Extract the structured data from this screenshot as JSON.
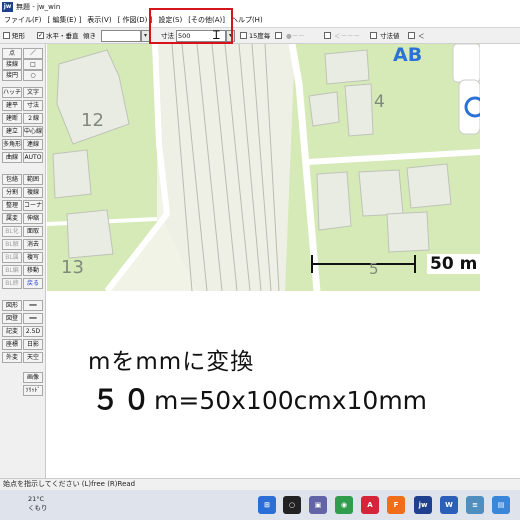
{
  "window": {
    "title": "無題 - jw_win",
    "app_icon_text": "jw"
  },
  "menu": [
    "ファイル(F)",
    "[ 編集(E) ]",
    "表示(V)",
    "[ 作図(D) ]",
    "設定(S)",
    "[その他(A)]",
    "ヘルプ(H)"
  ],
  "toolbar": {
    "rect_label": "矩形",
    "hv_label": "水平・垂直",
    "slope_label": "傾き",
    "dim_label": "寸法",
    "dim_value": "500",
    "step15_label": "15度毎",
    "dim_value_label": "寸法値",
    "disabled_a": "●－－",
    "disabled_b": "＜－－－",
    "lt_label": "＜"
  },
  "left_tools": [
    [
      "点",
      "／"
    ],
    [
      "接線",
      "□"
    ],
    [
      "接円",
      "○"
    ],
    [
      "ハッチ",
      "文字"
    ],
    [
      "建平",
      "寸法"
    ],
    [
      "建断",
      "２線"
    ],
    [
      "建立",
      "中心線"
    ],
    [
      "多角形",
      "連線"
    ],
    [
      "曲線",
      "AUTO"
    ],
    [
      "包絡",
      "範囲"
    ],
    [
      "分割",
      "複線"
    ],
    [
      "整理",
      "コーナー"
    ],
    [
      "属変",
      "伸縮"
    ],
    [
      "BL化",
      "面取"
    ],
    [
      "BL解",
      "消去"
    ],
    [
      "BL属",
      "複写"
    ],
    [
      "BL編",
      "移動"
    ],
    [
      "BL終",
      "戻る"
    ],
    [
      "図形",
      "━━"
    ],
    [
      "図登",
      "━━"
    ],
    [
      "記変",
      "2.5D"
    ],
    [
      "座標",
      "日影"
    ],
    [
      "外変",
      "天空"
    ],
    [
      "",
      "画像"
    ],
    [
      "",
      "ｿﾘｯﾄﾞ"
    ]
  ],
  "map": {
    "labels": {
      "block4": "4",
      "block12": "12",
      "block13": "13",
      "block5": "5",
      "ab": "AB"
    },
    "scale_label": "50 m"
  },
  "caption": {
    "line1": "mをmmに変換",
    "line2_big": "５０",
    "line2_rest": "m=50x100cmx10mm"
  },
  "status": {
    "text": "始点を指示してください (L)free (R)Read"
  },
  "taskbar": {
    "weather_temp": "21°C",
    "weather_cond": "くもり",
    "icons": [
      {
        "name": "windows-start-icon",
        "glyph": "⊞",
        "color": "#2b6fd6"
      },
      {
        "name": "search-icon",
        "glyph": "○",
        "color": "#222222"
      },
      {
        "name": "teams-icon",
        "glyph": "▣",
        "color": "#6264a7"
      },
      {
        "name": "chrome-icon",
        "glyph": "◉",
        "color": "#2f9d4c"
      },
      {
        "name": "acrobat-icon",
        "glyph": "A",
        "color": "#d6243a"
      },
      {
        "name": "f-app-icon",
        "glyph": "F",
        "color": "#f06d1a"
      },
      {
        "name": "jwwin-icon",
        "glyph": "jw",
        "color": "#1f3f8f"
      },
      {
        "name": "word-icon",
        "glyph": "W",
        "color": "#2b5fb8"
      },
      {
        "name": "notepad-icon",
        "glyph": "≡",
        "color": "#4f8fc0"
      },
      {
        "name": "photos-icon",
        "glyph": "▤",
        "color": "#3a86d8"
      }
    ]
  },
  "colors": {
    "highlight": "#d6131b",
    "map_green": "#d5eab6",
    "map_building": "#e9ece2",
    "scale_bar": "#111111"
  }
}
